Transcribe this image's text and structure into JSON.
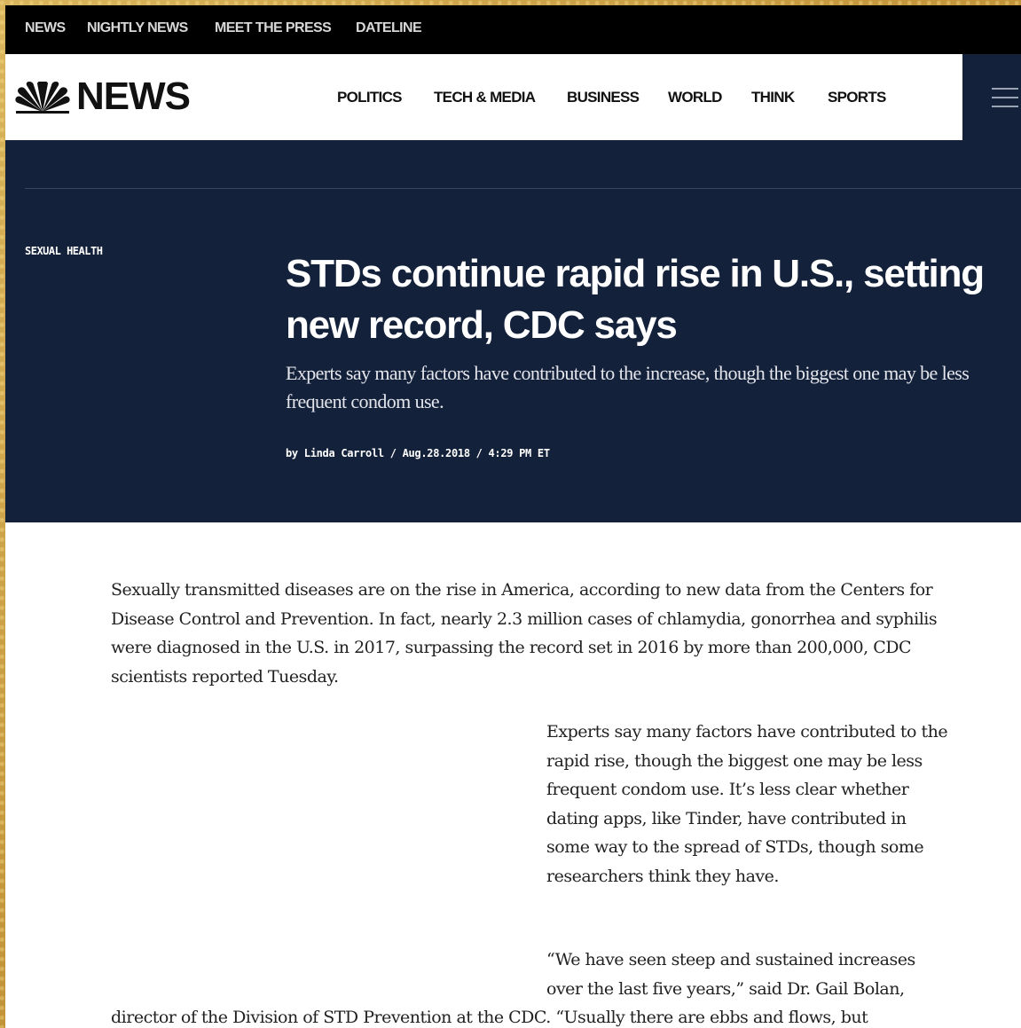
{
  "top_nav": {
    "items": [
      "NEWS",
      "NIGHTLY NEWS",
      "MEET THE PRESS",
      "DATELINE"
    ]
  },
  "header": {
    "logo_text": "NEWS",
    "logo_icon": "nbc-peacock-icon",
    "nav": [
      "POLITICS",
      "TECH & MEDIA",
      "BUSINESS",
      "WORLD",
      "THINK",
      "SPORTS"
    ],
    "menu_icon": "hamburger-menu-icon"
  },
  "article": {
    "section": "SEXUAL HEALTH",
    "headline": "STDs continue rapid rise in U.S., setting new record, CDC says",
    "dek": "Experts say many factors have contributed to the increase, though the biggest one may be less frequent condom use.",
    "byline": "by Linda Carroll / Aug.28.2018 / 4:29 PM ET",
    "paragraphs": [
      "Sexually transmitted diseases are on the rise in America, according to new data from the Centers for Disease Control and Prevention. In fact, nearly 2.3 million cases of chlamydia, gonorrhea and syphilis were diagnosed in the U.S. in 2017, surpassing the record set in 2016 by more than 200,000, CDC scientists reported Tuesday.",
      "Experts say many factors have contributed to the rapid rise, though the biggest one may be less frequent condom use. It’s less clear whether dating apps, like Tinder, have contributed in some way to the spread of STDs, though some researchers think they have.",
      "“We have seen steep and sustained increases over the last five years,” said Dr. Gail Bolan,",
      "director of the Division of STD Prevention at the CDC. “Usually there are ebbs and flows, but"
    ]
  },
  "colors": {
    "navy": "#14213a",
    "top_bar": "#000000",
    "frame": "#c9a24a"
  }
}
